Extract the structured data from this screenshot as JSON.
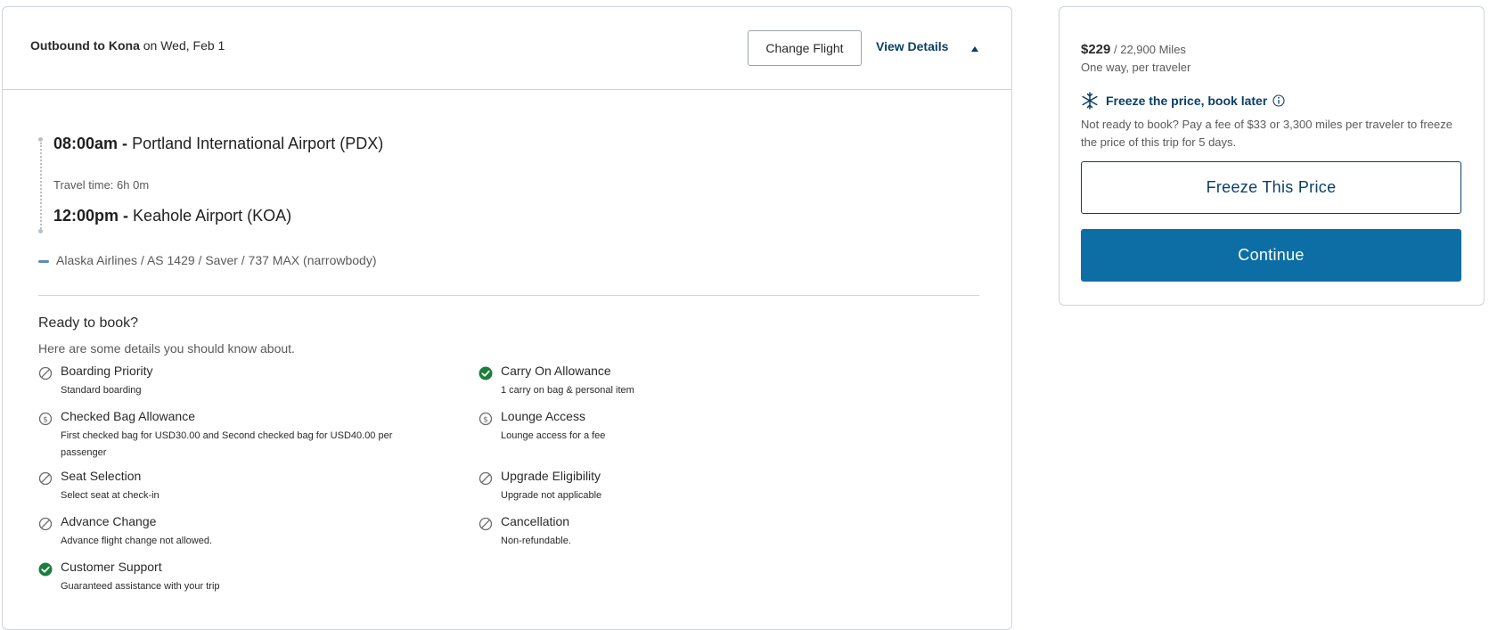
{
  "header": {
    "outbound_label": "Outbound to Kona",
    "outbound_date": " on Wed, Feb 1",
    "change_flight": "Change Flight",
    "view_details": "View Details"
  },
  "itinerary": {
    "depart_time": "08:00am -",
    "depart_airport": " Portland International Airport (PDX)",
    "travel_time": "Travel time: 6h 0m",
    "arrive_time": "12:00pm -",
    "arrive_airport": " Keahole Airport (KOA)",
    "flight_info": "Alaska Airlines / AS 1429 / Saver / 737 MAX (narrowbody)"
  },
  "ready": {
    "title": "Ready to book?",
    "subtitle": "Here are some details you should know about."
  },
  "features": [
    {
      "title": "Boarding Priority",
      "desc": "Standard boarding",
      "icon": "not-allowed-icon"
    },
    {
      "title": "Carry On Allowance",
      "desc": "1 carry on bag & personal item",
      "icon": "check-circle-icon"
    },
    {
      "title": "Checked Bag Allowance",
      "desc": "First checked bag for USD30.00 and Second checked bag for USD40.00 per passenger",
      "icon": "dollar-icon"
    },
    {
      "title": "Lounge Access",
      "desc": "Lounge access for a fee",
      "icon": "dollar-icon"
    },
    {
      "title": "Seat Selection",
      "desc": "Select seat at check-in",
      "icon": "not-allowed-icon"
    },
    {
      "title": "Upgrade Eligibility",
      "desc": "Upgrade not applicable",
      "icon": "not-allowed-icon"
    },
    {
      "title": "Advance Change",
      "desc": "Advance flight change not allowed.",
      "icon": "not-allowed-icon"
    },
    {
      "title": "Cancellation",
      "desc": "Non-refundable.",
      "icon": "not-allowed-icon"
    },
    {
      "title": "Customer Support",
      "desc": "Guaranteed assistance with your trip",
      "icon": "check-circle-icon"
    }
  ],
  "pricing": {
    "price": "$229",
    "miles": " / 22,900 Miles",
    "per_traveler": "One way, per traveler",
    "freeze_title": "Freeze the price, book later",
    "freeze_desc": "Not ready to book? Pay a fee of $33 or 3,300 miles per traveler to freeze the price of this trip for 5 days.",
    "freeze_button": "Freeze This Price",
    "continue_button": "Continue"
  },
  "colors": {
    "brand_dark": "#0b3f66",
    "brand_button": "#0d6ea5",
    "check_green": "#1a7f3c"
  }
}
